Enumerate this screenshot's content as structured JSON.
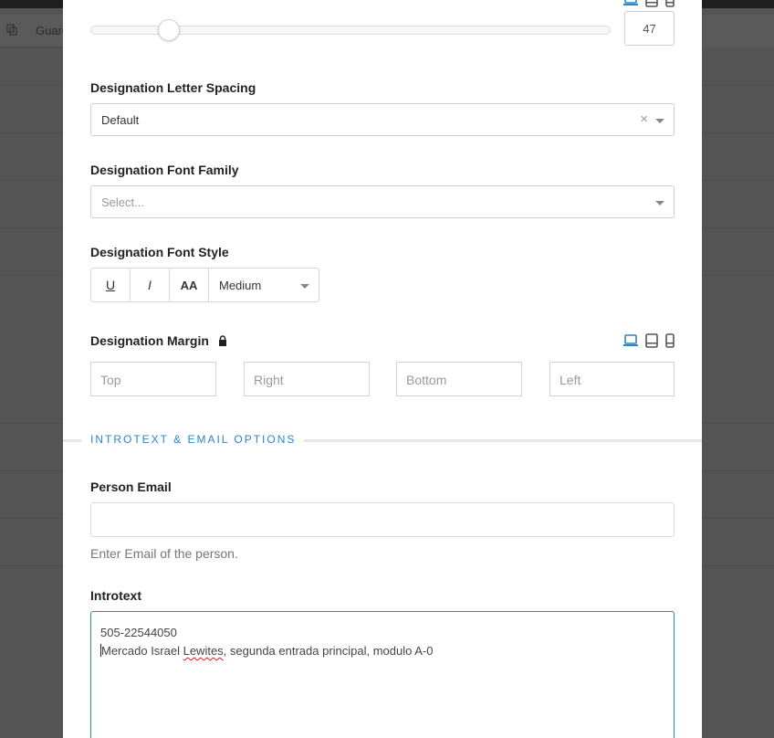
{
  "background": {
    "toolbar_label": "Guard",
    "copy_icon": "copy-icon"
  },
  "slider": {
    "value": "47",
    "fraction": 0.135
  },
  "letter_spacing": {
    "label": "Designation Letter Spacing",
    "value": "Default"
  },
  "font_family": {
    "label": "Designation Font Family",
    "placeholder": "Select..."
  },
  "font_style": {
    "label": "Designation Font Style",
    "underline": "U",
    "italic": "I",
    "uppercase": "AA",
    "weight": "Medium"
  },
  "margin": {
    "label": "Designation Margin",
    "top": "Top",
    "right": "Right",
    "bottom": "Bottom",
    "left": "Left"
  },
  "section": {
    "title": "INTROTEXT & EMAIL OPTIONS"
  },
  "email": {
    "label": "Person Email",
    "value": "",
    "help": "Enter Email of the person."
  },
  "introtext": {
    "label": "Introtext",
    "line1": "505-22544050",
    "line2_pre": "Mercado Israel ",
    "line2_misspelled": "Lewites",
    "line2_post": ", segunda entrada principal, modulo A-0"
  },
  "colors": {
    "accent": "#2b86c9",
    "overlay": "#545454"
  }
}
